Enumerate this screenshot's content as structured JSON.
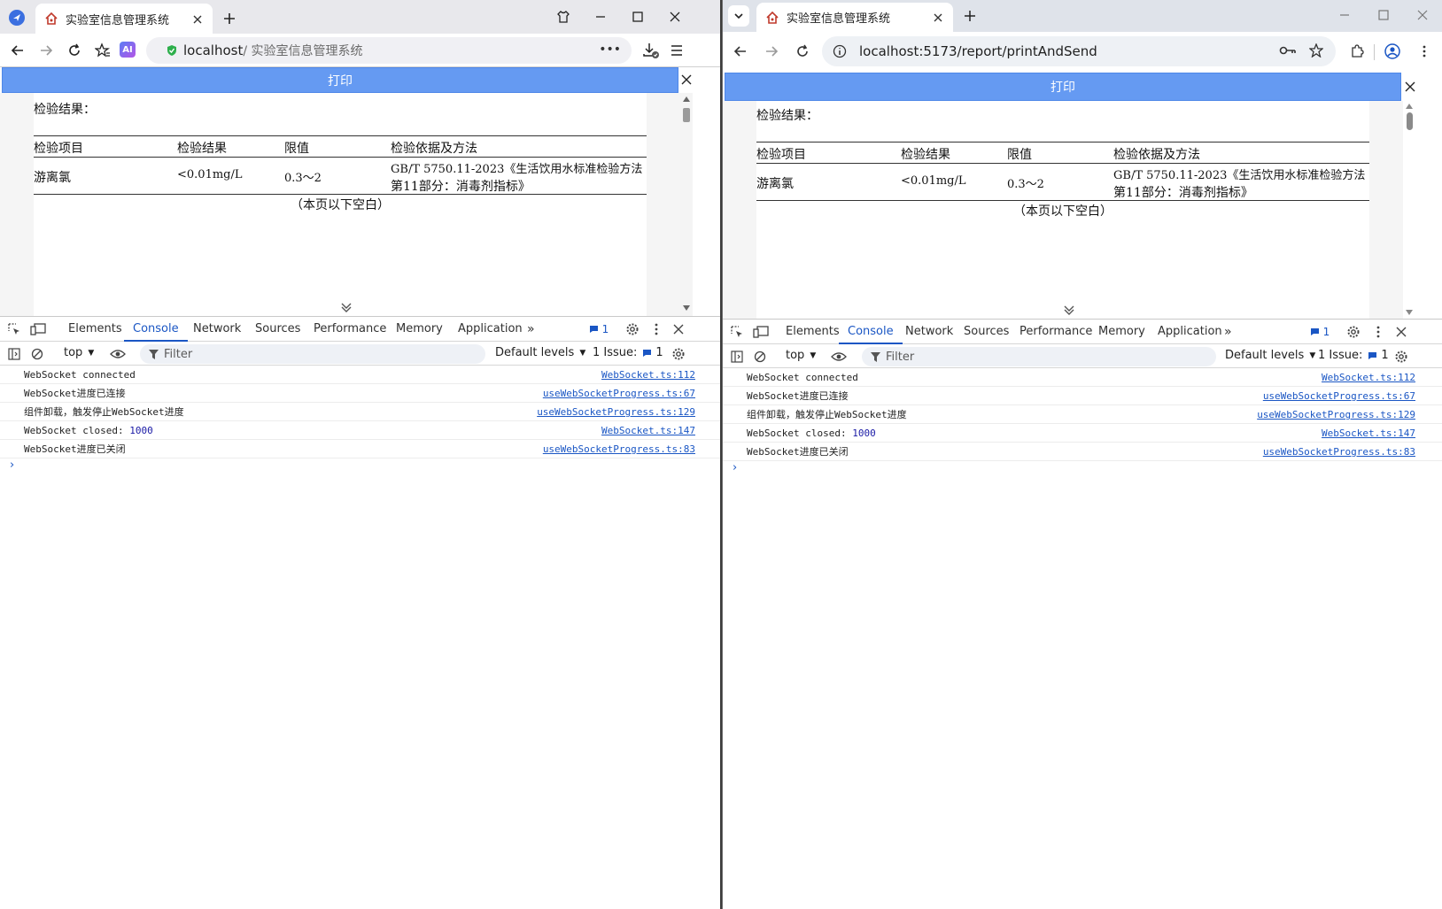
{
  "left": {
    "tab_title": "实验室信息管理系统",
    "address_host": "localhost",
    "address_rest": " / 实验室信息管理系统",
    "ai_label": "AI"
  },
  "right": {
    "tab_title": "实验室信息管理系统",
    "address": "localhost:5173/report/printAndSend"
  },
  "page": {
    "print_label": "打印",
    "section_label": "检验结果：",
    "headers": [
      "检验项目",
      "检验结果",
      "限值",
      "检验依据及方法"
    ],
    "row": {
      "item": "游离氯",
      "result": "<0.01mg/L",
      "limit": "0.3～2",
      "method_line1": "GB/T 5750.11-2023《生活饮用水标准检验方法",
      "method_line2": "第11部分：消毒剂指标》"
    },
    "blank_note": "（本页以下空白）"
  },
  "devtools": {
    "tabs": [
      "Elements",
      "Console",
      "Network",
      "Sources",
      "Performance",
      "Memory",
      "Application"
    ],
    "active_tab": "Console",
    "badge_count": "1",
    "context": "top",
    "filter_placeholder": "Filter",
    "levels": "Default levels",
    "issues_label": "1 Issue:",
    "issues_count": "1",
    "messages": [
      {
        "text": "WebSocket connected",
        "source": "WebSocket.ts:112"
      },
      {
        "text": "WebSocket进度已连接",
        "source": "useWebSocketProgress.ts:67"
      },
      {
        "text": "组件卸载，触发停止WebSocket进度",
        "source": "useWebSocketProgress.ts:129"
      },
      {
        "text_prefix": "WebSocket closed: ",
        "text_num": "1000",
        "source": "WebSocket.ts:147"
      },
      {
        "text": "WebSocket进度已关闭",
        "source": "useWebSocketProgress.ts:83"
      }
    ],
    "prompt": "›"
  },
  "colors": {
    "print_bar": "#659af2",
    "devtools_active": "#1a56c4",
    "tabstrip_left": "#e8e8ec",
    "tabstrip_right": "#dfe3ea"
  }
}
